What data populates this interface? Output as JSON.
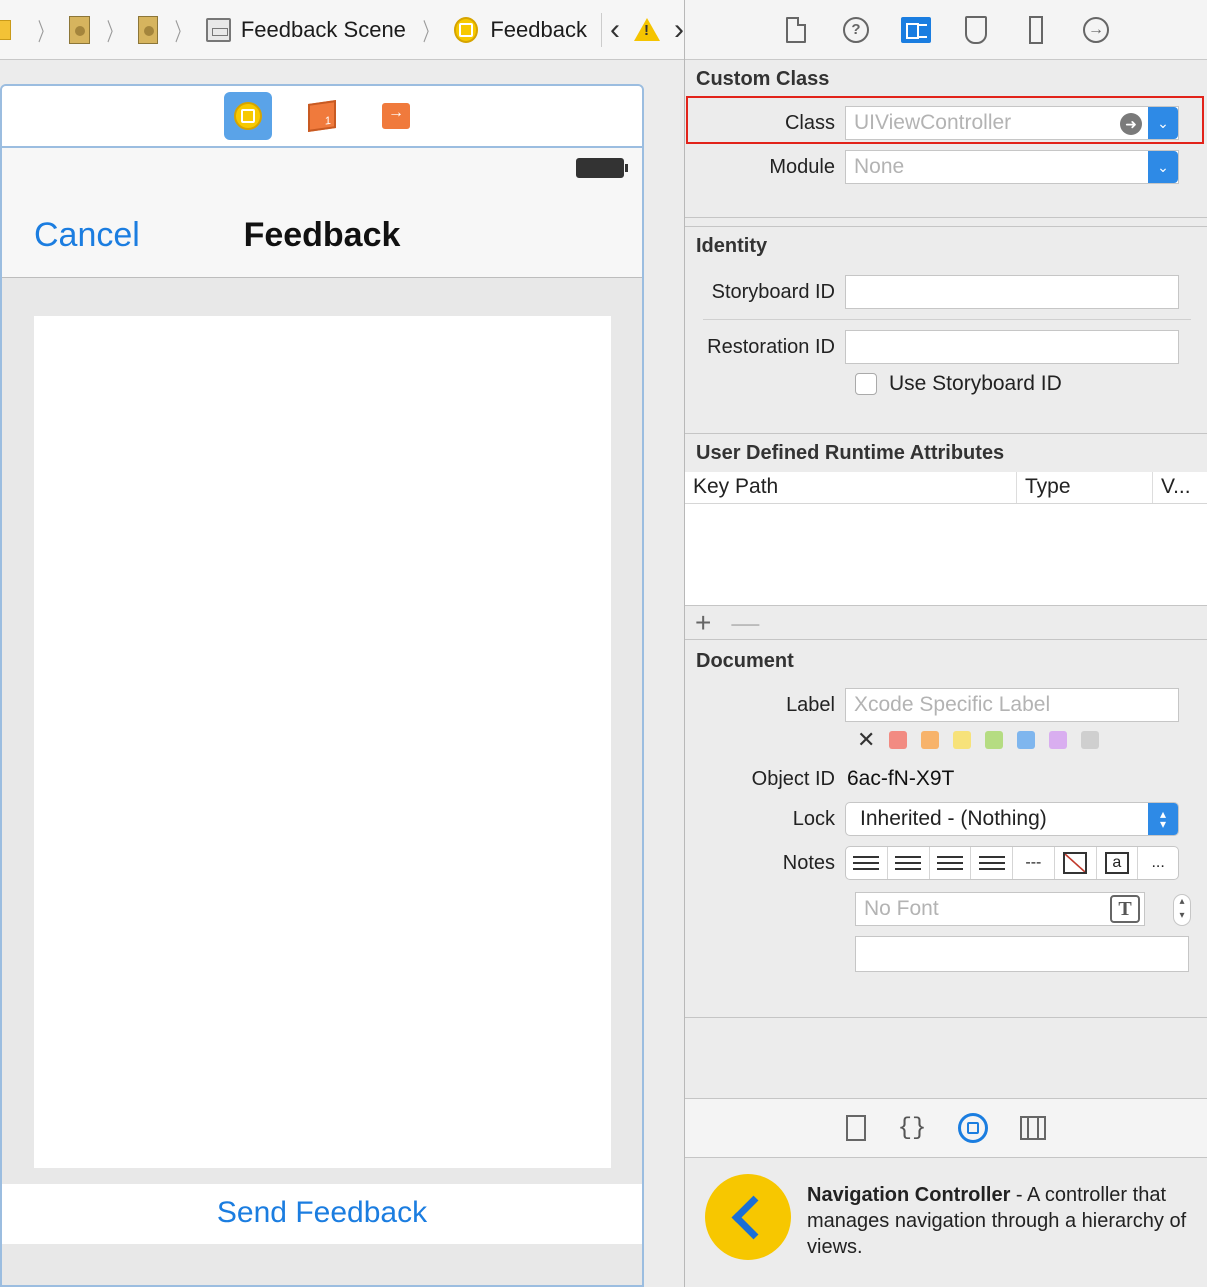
{
  "breadcrumb": {
    "scene_label": "Feedback Scene",
    "vc_label": "Feedback"
  },
  "canvas": {
    "nav_cancel": "Cancel",
    "nav_title": "Feedback",
    "bottom_button": "Send Feedback"
  },
  "inspector": {
    "custom_class": {
      "title": "Custom Class",
      "class_label": "Class",
      "class_placeholder": "UIViewController",
      "module_label": "Module",
      "module_placeholder": "None"
    },
    "identity": {
      "title": "Identity",
      "storyboard_id_label": "Storyboard ID",
      "restoration_id_label": "Restoration ID",
      "use_storyboard_id_label": "Use Storyboard ID"
    },
    "runtime_attrs": {
      "title": "User Defined Runtime Attributes",
      "columns": [
        "Key Path",
        "Type",
        "V..."
      ],
      "add": "+",
      "remove": "—"
    },
    "document": {
      "title": "Document",
      "label_label": "Label",
      "label_placeholder": "Xcode Specific Label",
      "clear_color": "✕",
      "colors": [
        "#f28b82",
        "#f7b36b",
        "#f7e27a",
        "#b5dc82",
        "#7fb6ee",
        "#d9aef0",
        "#cfcfcf"
      ],
      "object_id_label": "Object ID",
      "object_id_value": "6ac-fN-X9T",
      "lock_label": "Lock",
      "lock_value": "Inherited - (Nothing)",
      "notes_label": "Notes",
      "notes_strike": "---",
      "notes_more": "...",
      "font_placeholder": "No Font",
      "font_icon": "T",
      "notes_box_icon": "a"
    }
  },
  "library": {
    "item_name": "Navigation Controller",
    "item_desc": " - A controller that manages navigation through a hierarchy of views."
  },
  "colors": {
    "accent_blue": "#1b7de0",
    "highlight_red": "#e2231a",
    "icon_yellow": "#f7c900"
  }
}
